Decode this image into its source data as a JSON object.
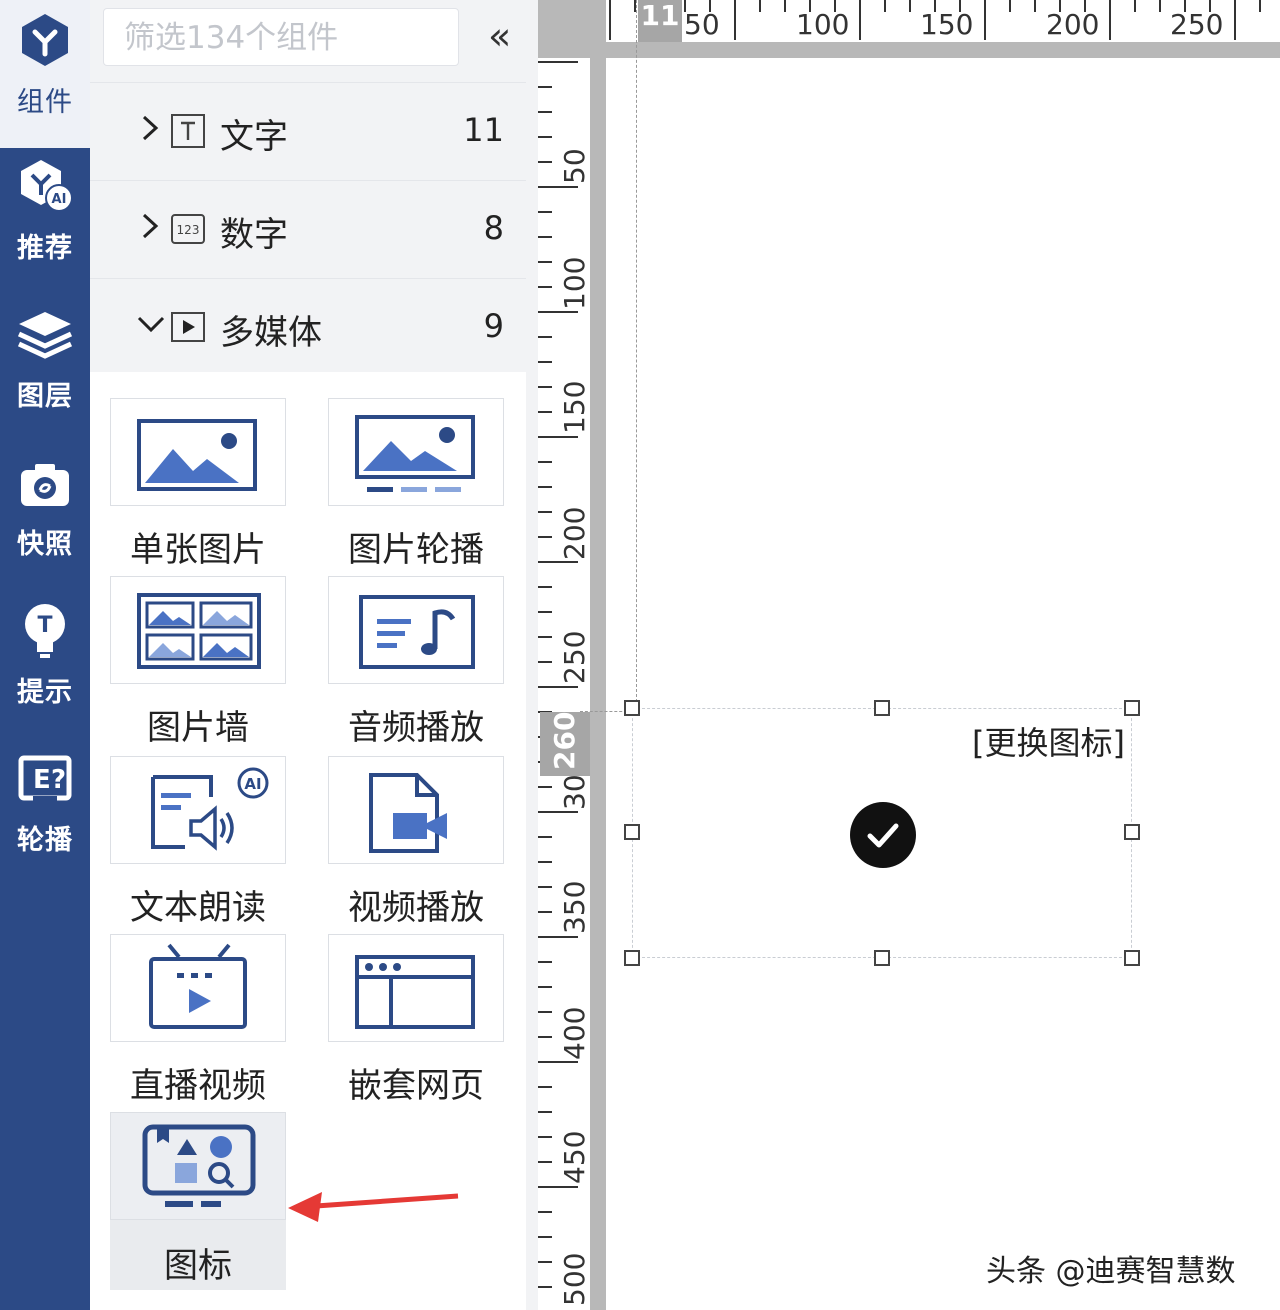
{
  "nav": {
    "items": [
      {
        "label": "组件",
        "icon": "cube-logo-icon",
        "active": true
      },
      {
        "label": "推荐",
        "icon": "ai-cube-icon",
        "active": false
      },
      {
        "label": "图层",
        "icon": "layers-icon",
        "active": false
      },
      {
        "label": "快照",
        "icon": "camera-icon",
        "active": false
      },
      {
        "label": "提示",
        "icon": "lightbulb-icon",
        "active": false
      },
      {
        "label": "轮播",
        "icon": "carousel-icon",
        "active": false
      }
    ]
  },
  "panel": {
    "search_placeholder": "筛选134个组件",
    "collapse_label": "«",
    "categories": [
      {
        "name": "文字",
        "count": "11",
        "icon": "text-icon",
        "expanded": false
      },
      {
        "name": "数字",
        "count": "8",
        "icon": "number-icon",
        "expanded": false
      },
      {
        "name": "多媒体",
        "count": "9",
        "icon": "media-play-icon",
        "expanded": true
      }
    ],
    "components": [
      {
        "label": "单张图片",
        "icon": "single-image-icon"
      },
      {
        "label": "图片轮播",
        "icon": "image-carousel-icon"
      },
      {
        "label": "图片墙",
        "icon": "image-wall-icon"
      },
      {
        "label": "音频播放",
        "icon": "audio-play-icon"
      },
      {
        "label": "文本朗读",
        "icon": "text-to-speech-icon"
      },
      {
        "label": "视频播放",
        "icon": "video-play-icon"
      },
      {
        "label": "直播视频",
        "icon": "live-video-icon"
      },
      {
        "label": "嵌套网页",
        "icon": "embedded-webpage-icon"
      },
      {
        "label": "图标",
        "icon": "icon-component-icon",
        "selected": true
      }
    ]
  },
  "ruler": {
    "horizontal_marker": "11",
    "horizontal_ticks": [
      "50",
      "100",
      "150",
      "200",
      "250"
    ],
    "vertical_marker": "260",
    "vertical_ticks": [
      "50",
      "100",
      "150",
      "200",
      "250",
      "300",
      "350",
      "400",
      "450",
      "500"
    ]
  },
  "canvas": {
    "replace_icon_label": "[更换图标]"
  },
  "watermark": "头条 @迪赛智慧数",
  "colors": {
    "nav_bg": "#2c4a86",
    "accent": "#2c4a86",
    "icon_blue": "#4a72c4",
    "arrow_red": "#e53935"
  }
}
